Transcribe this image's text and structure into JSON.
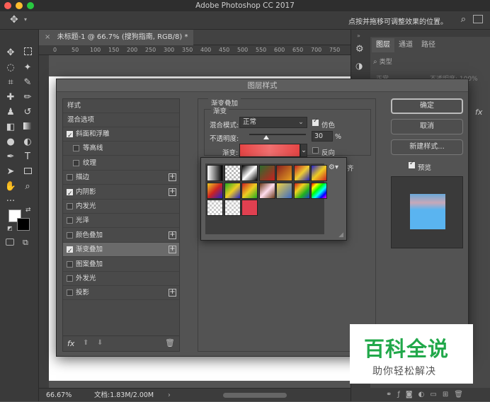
{
  "app": {
    "title": "Adobe Photoshop CC 2017",
    "options_hint": "点按并拖移可调整效果的位置。"
  },
  "document": {
    "tab_label": "未标题-1 @ 66.7% (搜狗指南, RGB/8) *",
    "zoom": "66.67%",
    "doc_size": "文档:1.83M/2.00M",
    "ruler_ticks": [
      "0",
      "50",
      "100",
      "150",
      "200",
      "250",
      "300",
      "350",
      "400",
      "450",
      "500",
      "550",
      "600",
      "650",
      "700",
      "750"
    ]
  },
  "panels": {
    "tabs": [
      "图层",
      "通道",
      "路径"
    ],
    "filter_label": "类型",
    "blend_hint": "正常",
    "opacity_hint": "不透明度: 100%"
  },
  "dialog": {
    "title": "图层样式",
    "styles_header": "样式",
    "blend_options": "混合选项",
    "items": [
      {
        "label": "斜面和浮雕",
        "checked": true,
        "indent": false,
        "plus": false,
        "selected": false
      },
      {
        "label": "等高线",
        "checked": false,
        "indent": true,
        "plus": false,
        "selected": false
      },
      {
        "label": "纹理",
        "checked": false,
        "indent": true,
        "plus": false,
        "selected": false
      },
      {
        "label": "描边",
        "checked": false,
        "indent": false,
        "plus": true,
        "selected": false
      },
      {
        "label": "内阴影",
        "checked": true,
        "indent": false,
        "plus": true,
        "selected": false
      },
      {
        "label": "内发光",
        "checked": false,
        "indent": false,
        "plus": false,
        "selected": false
      },
      {
        "label": "光泽",
        "checked": false,
        "indent": false,
        "plus": false,
        "selected": false
      },
      {
        "label": "颜色叠加",
        "checked": false,
        "indent": false,
        "plus": true,
        "selected": false
      },
      {
        "label": "渐变叠加",
        "checked": true,
        "indent": false,
        "plus": true,
        "selected": true
      },
      {
        "label": "图案叠加",
        "checked": false,
        "indent": false,
        "plus": false,
        "selected": false
      },
      {
        "label": "外发光",
        "checked": false,
        "indent": false,
        "plus": false,
        "selected": false
      },
      {
        "label": "投影",
        "checked": false,
        "indent": false,
        "plus": true,
        "selected": false
      }
    ],
    "section_title": "渐变叠加",
    "group_title": "渐变",
    "blend_mode_label": "混合模式:",
    "blend_mode_value": "正常",
    "dither_label": "仿色",
    "dither_checked": true,
    "opacity_label": "不透明度:",
    "opacity_value": "30",
    "opacity_unit": "%",
    "opacity_fraction": 0.3,
    "gradient_label": "渐变:",
    "reverse_label": "反向",
    "reverse_checked": false,
    "align_label_partial": "齐",
    "buttons": {
      "ok": "确定",
      "cancel": "取消",
      "new_style": "新建样式...",
      "preview": "预览"
    },
    "preview_checked": true,
    "fx_label": "fx"
  },
  "gradient_swatches": [
    "linear-gradient(90deg,#fff,#000)",
    "checker-bw",
    "linear-gradient(135deg,#000,#fff,#000)",
    "linear-gradient(135deg,#2d6b2d,#c82020)",
    "linear-gradient(135deg,#8a1f1f,#e6a020)",
    "linear-gradient(135deg,#b22,#ec3,#22b)",
    "linear-gradient(135deg,#22c,#ec2,#c22)",
    "linear-gradient(135deg,#ec2,#c22,#22c)",
    "linear-gradient(135deg,#2a2,#ec2,#22c)",
    "linear-gradient(135deg,#c22,#ec2,#2a2)",
    "linear-gradient(135deg,#6a3a1a,#fde,#6a3a1a)",
    "linear-gradient(135deg,#f0d040,#3a6ac8)",
    "linear-gradient(135deg,#d02020,#f0d020,#20b020,#2040d0)",
    "linear-gradient(135deg,#f00,#ff0,#0f0,#0ff,#00f,#f0f)",
    "checker-light",
    "checker-light",
    "linear-gradient(90deg,#e04050,#e04050)"
  ],
  "watermark": {
    "main": "百科全说",
    "sub": "助你轻松解决"
  },
  "colors": {
    "bg": "#535353",
    "dialog_bg": "#535353",
    "gradient_bar": "#e54545",
    "watermark_green": "#21a84a",
    "preview_sky": "#5ab4f0"
  }
}
